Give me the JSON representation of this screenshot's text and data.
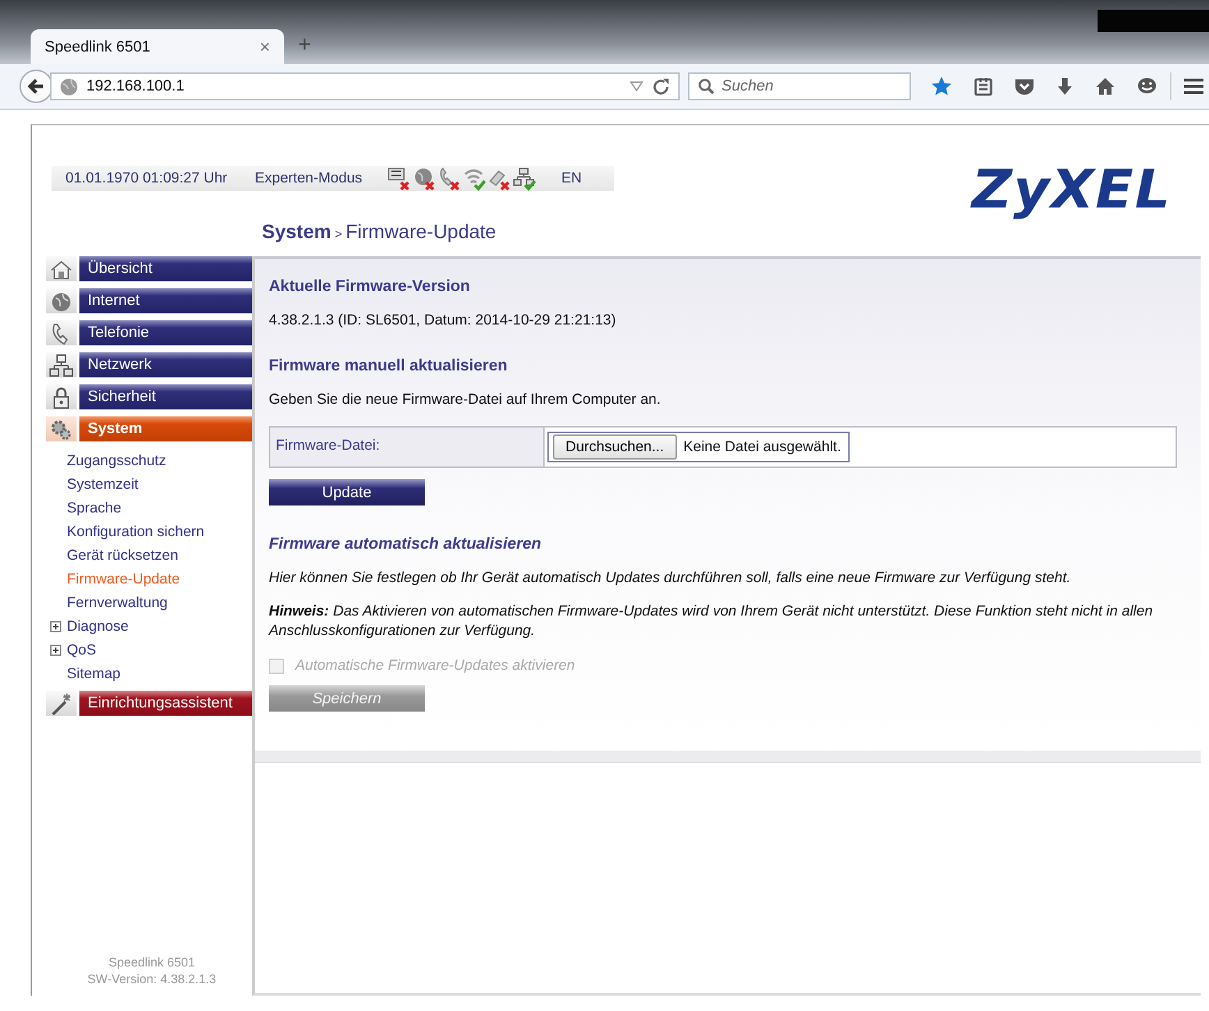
{
  "browser": {
    "tab_title": "Speedlink 6501",
    "new_tab": "+",
    "tab_close": "×",
    "url": "192.168.100.1",
    "search": {
      "placeholder": "Suchen"
    }
  },
  "header": {
    "datetime": "01.01.1970 01:09:27 Uhr",
    "mode": "Experten-Modus",
    "status_icons": [
      {
        "kind": "dsl",
        "ok": false
      },
      {
        "kind": "globe",
        "ok": false
      },
      {
        "kind": "phone",
        "ok": false
      },
      {
        "kind": "wifi",
        "ok": true
      },
      {
        "kind": "usb",
        "ok": false
      },
      {
        "kind": "lan",
        "ok": true
      }
    ],
    "language": "EN",
    "logo": "ZyXEL"
  },
  "breadcrumb": {
    "section": "System",
    "separator": ">",
    "page": "Firmware-Update"
  },
  "sidebar": {
    "items": [
      {
        "label": "Übersicht",
        "kind": "section",
        "selected": false
      },
      {
        "label": "Internet",
        "kind": "section",
        "selected": false
      },
      {
        "label": "Telefonie",
        "kind": "section",
        "selected": false
      },
      {
        "label": "Netzwerk",
        "kind": "section",
        "selected": false
      },
      {
        "label": "Sicherheit",
        "kind": "section",
        "selected": false
      },
      {
        "label": "System",
        "kind": "section",
        "selected": true,
        "children": [
          {
            "label": "Zugangsschutz",
            "kind": "link",
            "selected": false
          },
          {
            "label": "Systemzeit",
            "kind": "link",
            "selected": false
          },
          {
            "label": "Sprache",
            "kind": "link",
            "selected": false
          },
          {
            "label": "Konfiguration sichern",
            "kind": "link",
            "selected": false
          },
          {
            "label": "Gerät rücksetzen",
            "kind": "link",
            "selected": false
          },
          {
            "label": "Firmware-Update",
            "kind": "link",
            "selected": true
          },
          {
            "label": "Fernverwaltung",
            "kind": "link",
            "selected": false
          },
          {
            "label": "Diagnose",
            "kind": "group",
            "selected": false
          },
          {
            "label": "QoS",
            "kind": "group",
            "selected": false
          },
          {
            "label": "Sitemap",
            "kind": "link",
            "selected": false
          }
        ]
      },
      {
        "label": "Einrichtungsassistent",
        "kind": "wizard",
        "selected": false
      }
    ],
    "footer": [
      "Speedlink 6501",
      "SW-Version: 4.38.2.1.3"
    ]
  },
  "content": {
    "current": {
      "heading": "Aktuelle Firmware-Version",
      "text": "4.38.2.1.3 (ID: SL6501, Datum: 2014-10-29 21:21:13)"
    },
    "manual": {
      "heading": "Firmware manuell aktualisieren",
      "text": "Geben Sie die neue Firmware-Datei auf Ihrem Computer an.",
      "field_label": "Firmware-Datei:",
      "browse_button": "Durchsuchen...",
      "file_status": "Keine Datei ausgewählt.",
      "button": {
        "label": "Update",
        "disabled": false
      }
    },
    "automatic": {
      "heading": "Firmware automatisch aktualisieren",
      "text": "Hier können Sie festlegen ob Ihr Gerät automatisch Updates durchführen soll, falls eine neue Firmware zur Verfügung steht.",
      "note": "**Hinweis:** Das Aktivieren von automatischen Firmware-Updates wird von Ihrem Gerät nicht unterstützt. Diese Funktion steht nicht in allen Anschlusskonfigurationen zur Verfügung.",
      "checkbox": {
        "label": "Automatische Firmware-Updates aktivieren",
        "checked": false,
        "disabled": true
      },
      "button": {
        "label": "Speichern",
        "disabled": true
      }
    }
  }
}
